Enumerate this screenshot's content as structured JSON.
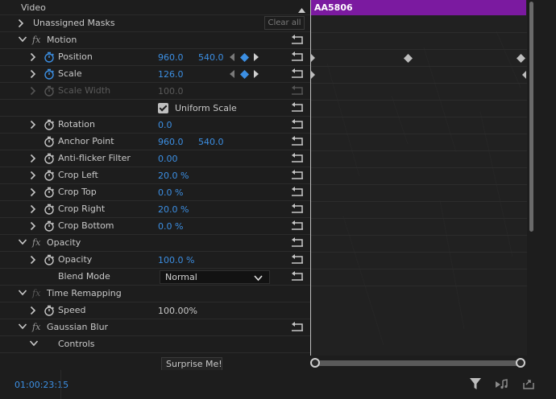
{
  "header": {
    "title": "Video"
  },
  "clip": {
    "name": "AA5806",
    "color": "#7b1aa0"
  },
  "rows": {
    "unassigned_masks": {
      "label": "Unassigned Masks",
      "clear_all": "Clear all"
    },
    "motion": {
      "label": "Motion"
    },
    "position": {
      "label": "Position",
      "x": "960.0",
      "y": "540.0"
    },
    "scale": {
      "label": "Scale",
      "value": "126.0"
    },
    "scale_width": {
      "label": "Scale Width",
      "value": "100.0"
    },
    "uniform_scale": {
      "label": "Uniform Scale",
      "checked": true
    },
    "rotation": {
      "label": "Rotation",
      "value": "0.0"
    },
    "anchor_point": {
      "label": "Anchor Point",
      "x": "960.0",
      "y": "540.0"
    },
    "anti_flicker": {
      "label": "Anti-flicker Filter",
      "value": "0.00"
    },
    "crop_left": {
      "label": "Crop Left",
      "value": "20.0 %"
    },
    "crop_top": {
      "label": "Crop Top",
      "value": "0.0 %"
    },
    "crop_right": {
      "label": "Crop Right",
      "value": "20.0 %"
    },
    "crop_bottom": {
      "label": "Crop Bottom",
      "value": "0.0 %"
    },
    "opacity_group": {
      "label": "Opacity"
    },
    "opacity": {
      "label": "Opacity",
      "value": "100.0 %"
    },
    "blend_mode": {
      "label": "Blend Mode",
      "value": "Normal"
    },
    "time_remapping": {
      "label": "Time Remapping"
    },
    "speed": {
      "label": "Speed",
      "value": "100.00%"
    },
    "gaussian_blur": {
      "label": "Gaussian Blur"
    },
    "controls": {
      "label": "Controls"
    }
  },
  "popup": {
    "text": "Surprise Me!"
  },
  "footer": {
    "timecode": "01:00:23:15"
  },
  "colors": {
    "accent_value": "#3c8fe3",
    "keyframe_active": "#3c8fe3",
    "clip": "#7b1aa0"
  },
  "icons": [
    "chevron-right-icon",
    "chevron-down-icon",
    "fx-icon",
    "stopwatch-icon",
    "reset-icon",
    "keyframe-prev-icon",
    "keyframe-add-icon",
    "keyframe-next-icon",
    "filter-icon",
    "play-audio-icon",
    "export-icon",
    "collapse-caret-icon"
  ]
}
